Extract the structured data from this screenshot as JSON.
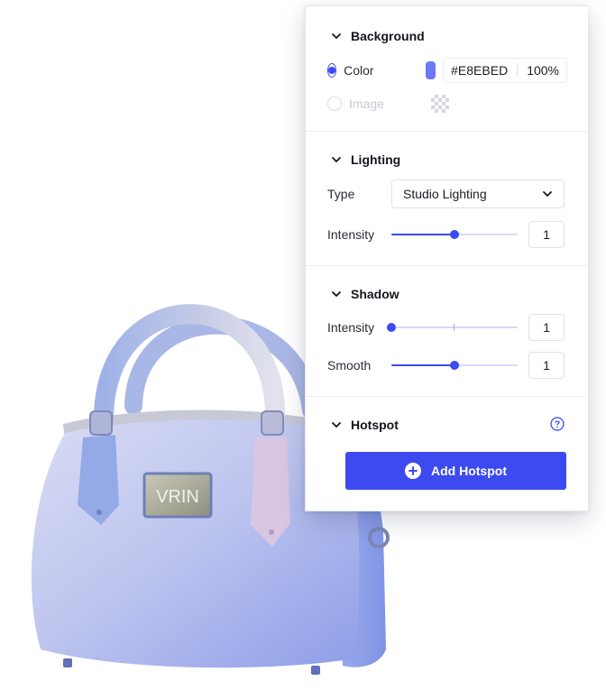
{
  "background": {
    "title": "Background",
    "color_label": "Color",
    "color_hex": "#E8EBED",
    "color_opacity": "100%",
    "swatch_color": "#6c79f8",
    "image_label": "Image"
  },
  "lighting": {
    "title": "Lighting",
    "type_label": "Type",
    "type_value": "Studio Lighting",
    "intensity_label": "Intensity",
    "intensity_value": "1",
    "intensity_slider": 0.5
  },
  "shadow": {
    "title": "Shadow",
    "intensity_label": "Intensity",
    "intensity_value": "1",
    "intensity_slider": 0.0,
    "smooth_label": "Smooth",
    "smooth_value": "1",
    "smooth_slider": 0.5
  },
  "hotspot": {
    "title": "Hotspot",
    "add_label": "Add Hotspot"
  },
  "product": {
    "plate_text": "VRIN"
  },
  "colors": {
    "accent": "#3d4af0"
  }
}
